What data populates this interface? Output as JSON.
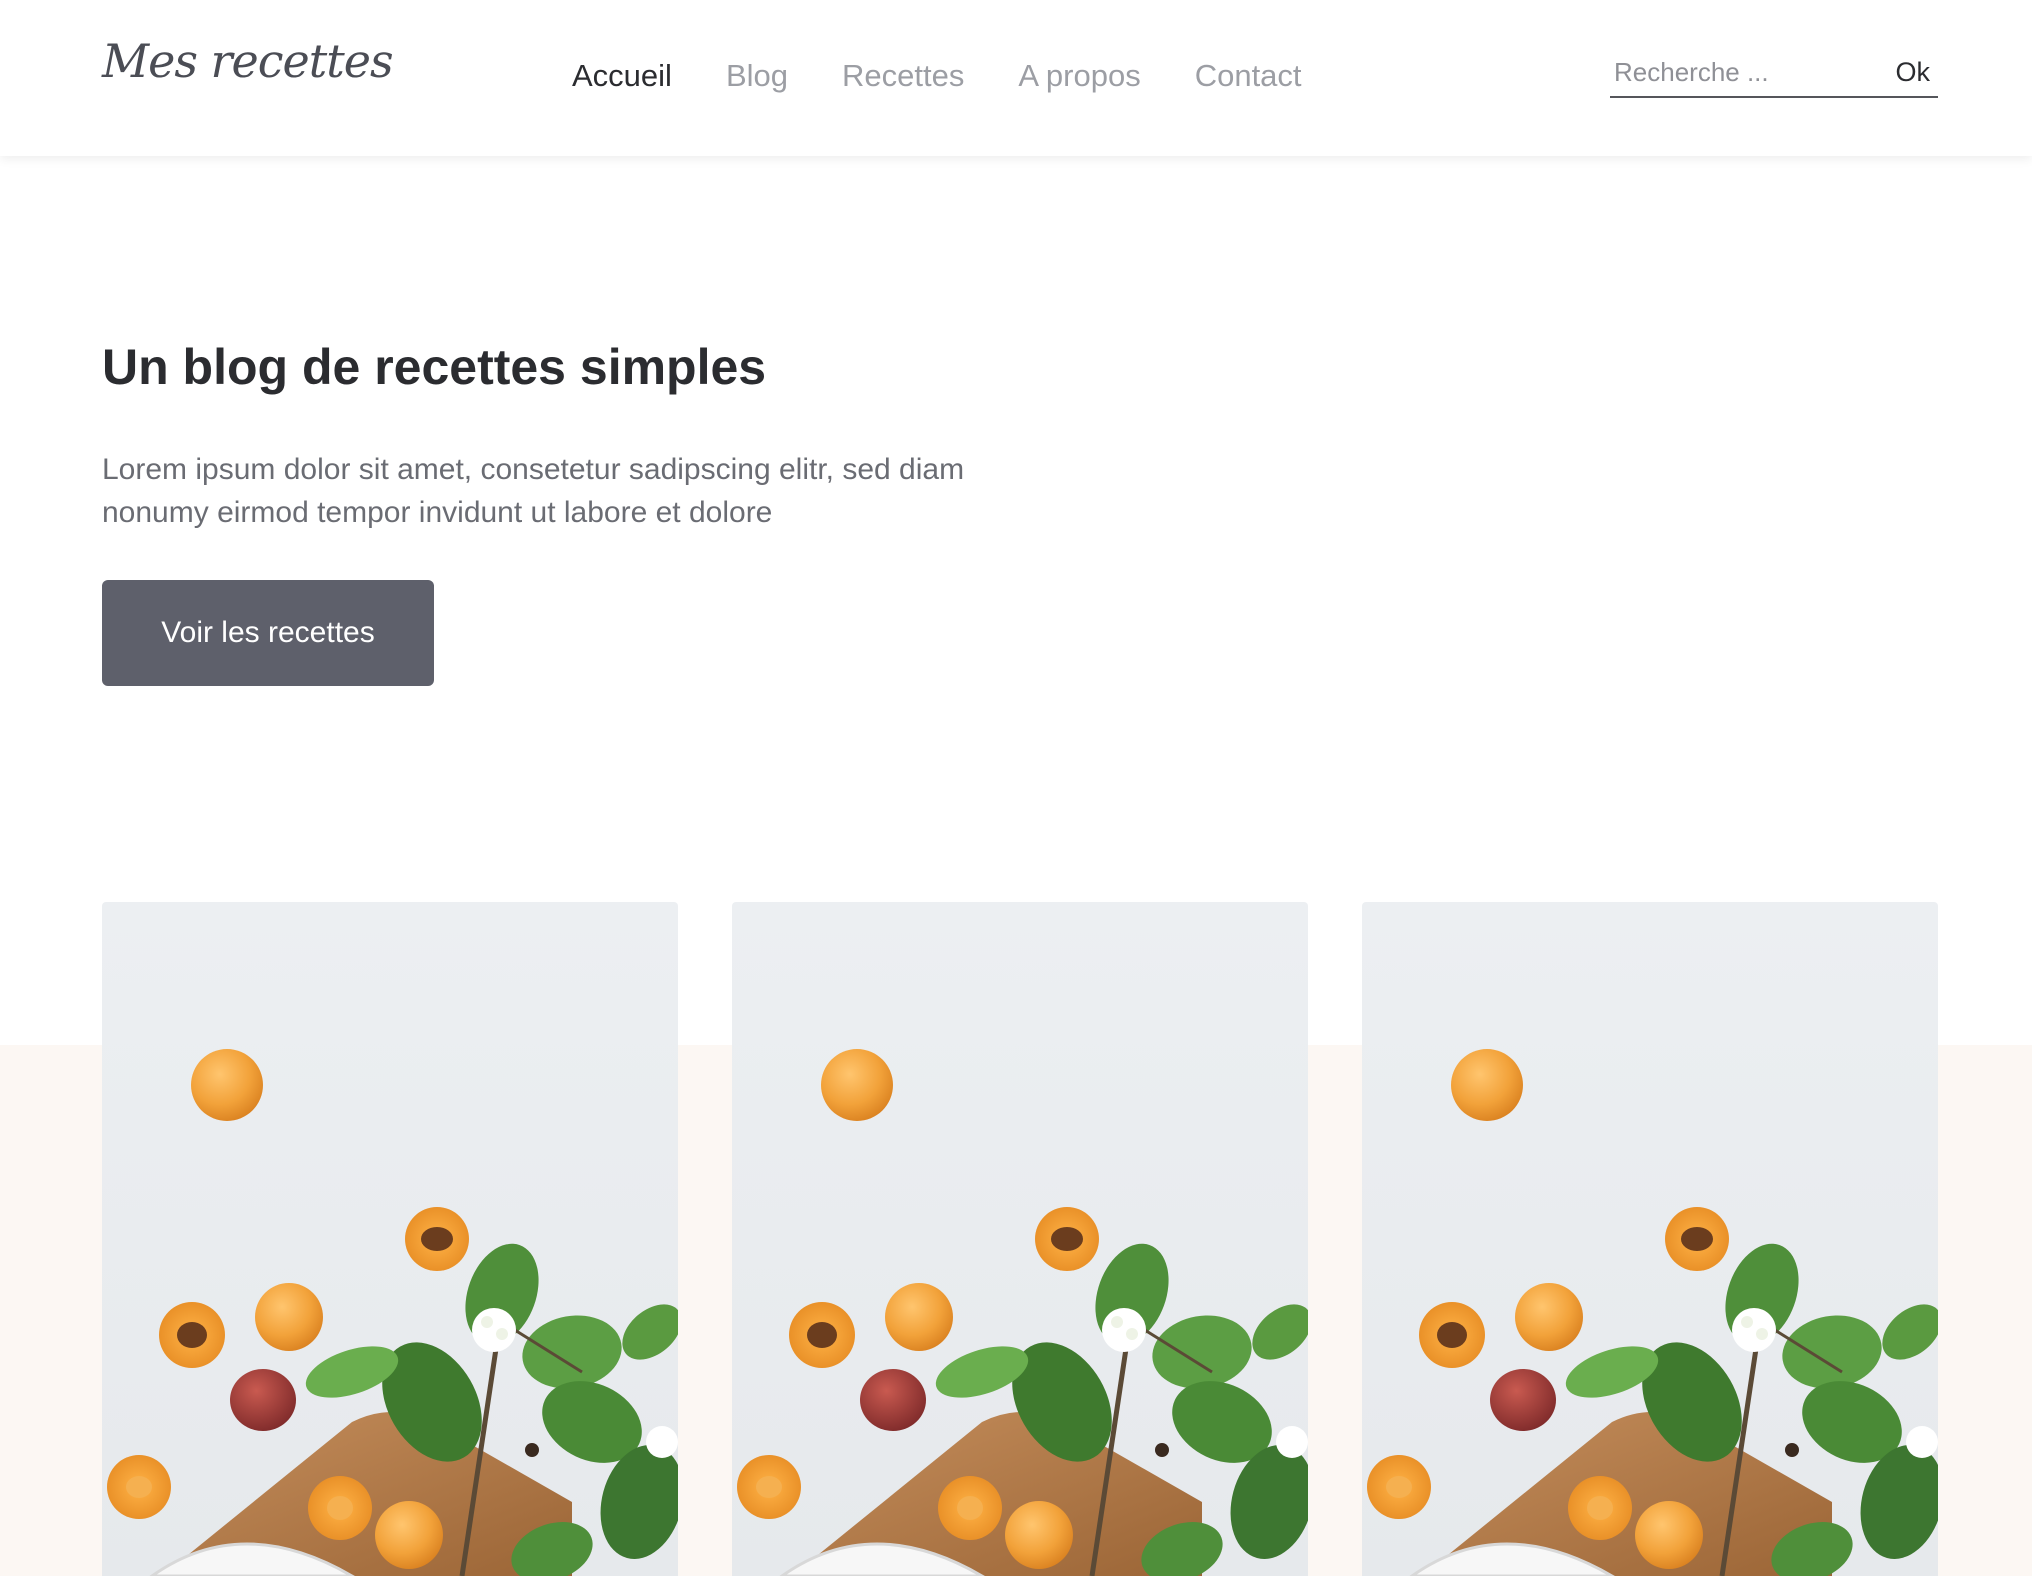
{
  "header": {
    "logo": "Mes recettes",
    "nav": [
      {
        "label": "Accueil",
        "active": true
      },
      {
        "label": "Blog",
        "active": false
      },
      {
        "label": "Recettes",
        "active": false
      },
      {
        "label": "A propos",
        "active": false
      },
      {
        "label": "Contact",
        "active": false
      }
    ],
    "search": {
      "placeholder": "Recherche ...",
      "value": "",
      "button_label": "Ok"
    }
  },
  "hero": {
    "title": "Un blog de recettes simples",
    "text": "Lorem ipsum dolor sit amet, consetetur sadipscing elitr, sed diam nonumy eirmod tempor invidunt ut labore et dolore",
    "button_label": "Voir les recettes"
  },
  "cards": [
    {
      "image": "apricots-photo"
    },
    {
      "image": "apricots-photo"
    },
    {
      "image": "apricots-photo"
    }
  ],
  "colors": {
    "button_bg": "#5e606b",
    "band_bg": "#fcf7f3",
    "nav_active": "#2b2c30",
    "nav_inactive": "#9c9ea4"
  }
}
